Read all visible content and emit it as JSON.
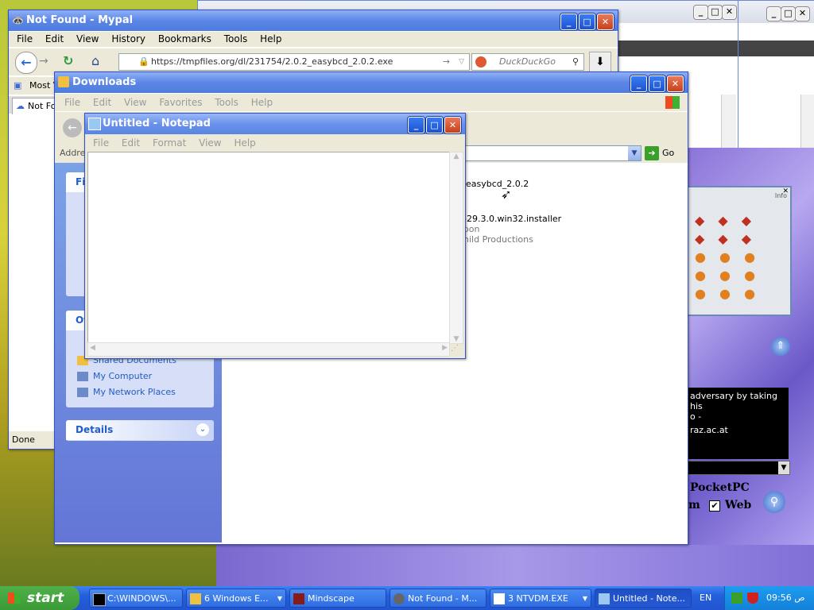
{
  "colors": {
    "xp_blue": "#245edb",
    "title_blue": "#5b86e6",
    "close_red": "#c8401c",
    "start_green": "#3a9a36",
    "panel_link": "#215dc6"
  },
  "browser": {
    "title": "Not Found - Mypal",
    "menu": [
      "File",
      "Edit",
      "View",
      "History",
      "Bookmarks",
      "Tools",
      "Help"
    ],
    "url": "https://tmpfiles.org/dl/231754/2.0.2_easybcd_2.0.2.exe",
    "search_placeholder": "DuckDuckGo",
    "bookmark_label": "Most V",
    "tab_label": "Not Fo",
    "status": "Done"
  },
  "explorer": {
    "title": "Downloads",
    "menu": [
      "File",
      "Edit",
      "View",
      "Favorites",
      "Tools",
      "Help"
    ],
    "address_label": "Addres",
    "go_label": "Go",
    "files": [
      {
        "name": "easybcd_2.0.2"
      },
      {
        "name": "-29.3.0.win32.installer",
        "line2": "oon",
        "line3": "hild Productions"
      }
    ],
    "panel_file_head": "Fil",
    "panel_other_head": "Ot",
    "other_places": [
      "Shared Documents",
      "My Computer",
      "My Network Places"
    ],
    "details_head": "Details"
  },
  "notepad": {
    "title": "Untitled - Notepad",
    "menu": [
      "File",
      "Edit",
      "Format",
      "View",
      "Help"
    ],
    "content": ""
  },
  "mindscape": {
    "text_line1": "adversary by taking his",
    "text_line2": "o -",
    "text_line3": "raz.ac.at",
    "pocketpc": "PocketPC",
    "web_label": "Web",
    "m_label": "m",
    "web_checked": true,
    "info_label": "Info"
  },
  "taskbar": {
    "start": "start",
    "tasks": [
      {
        "label": "C:\\WINDOWS\\..."
      },
      {
        "label": "6 Windows E..."
      },
      {
        "label": "Mindscape"
      },
      {
        "label": "Not Found - M..."
      },
      {
        "label": "3 NTVDM.EXE"
      },
      {
        "label": "Untitled - Note..."
      }
    ],
    "lang": "EN",
    "clock": "09:56 ص"
  }
}
